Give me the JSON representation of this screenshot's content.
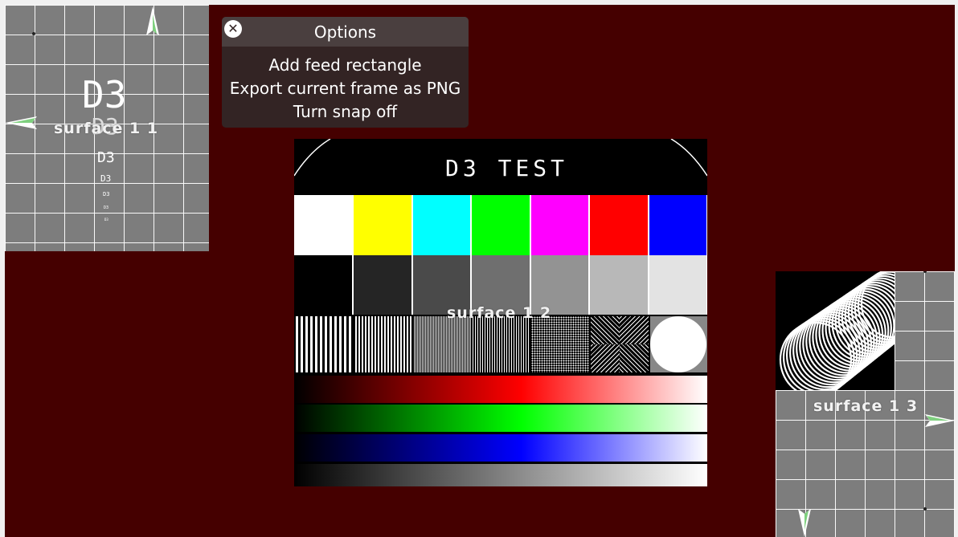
{
  "menu": {
    "title": "Options",
    "close_glyph": "✕",
    "items": [
      "Add feed rectangle",
      "Export current frame as PNG",
      "Turn snap off"
    ]
  },
  "surfaces": {
    "s1": {
      "label": "surface 1 1",
      "content": [
        "D3",
        "D3",
        "D3",
        "D3",
        "D3",
        "D3",
        "D3"
      ]
    },
    "s2": {
      "label": "surface 1 2",
      "title": "D3 TEST"
    },
    "s3": {
      "label": "surface 1 3"
    }
  },
  "colors": {
    "background": "#450000",
    "surface_grey": "#7d7d7d",
    "menu_bg": "#332424",
    "handle_green": "#7fd07f",
    "colour_bars": [
      "#ffffff",
      "#ffff00",
      "#00ffff",
      "#00ff00",
      "#ff00ff",
      "#ff0000",
      "#0000ff"
    ],
    "grey_bars": [
      "#000000",
      "#252525",
      "#4a4a4a",
      "#6f6f6f",
      "#939393",
      "#b8b8b8",
      "#e3e3e3"
    ],
    "ramps": [
      "#ff0000",
      "#00ff00",
      "#0000ff",
      "#ffffff"
    ]
  },
  "icons": [
    "close-icon",
    "drag-arrow-icon"
  ]
}
